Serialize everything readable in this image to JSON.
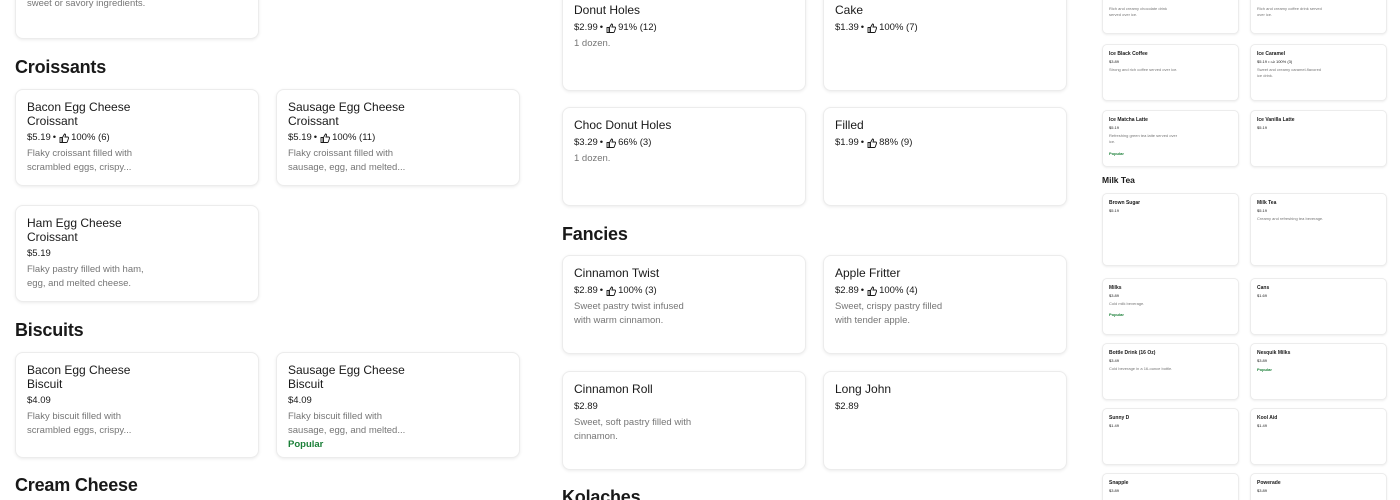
{
  "left": {
    "top_card_desc": "sweet or savory ingredients.",
    "croissants_title": "Croissants",
    "croissants": [
      {
        "name": "Bacon Egg Cheese Croissant",
        "price": "$5.19",
        "rating": "100% (6)",
        "desc": "Flaky croissant filled with scrambled eggs, crispy..."
      },
      {
        "name": "Sausage Egg Cheese Croissant",
        "price": "$5.19",
        "rating": "100% (11)",
        "desc": "Flaky croissant filled with sausage, egg, and melted..."
      },
      {
        "name": "Ham Egg Cheese Croissant",
        "price": "$5.19",
        "desc": "Flaky pastry filled with ham, egg, and melted cheese."
      }
    ],
    "biscuits_title": "Biscuits",
    "biscuits": [
      {
        "name": "Bacon Egg Cheese Biscuit",
        "price": "$4.09",
        "desc": "Flaky biscuit filled with scrambled eggs, crispy..."
      },
      {
        "name": "Sausage Egg Cheese Biscuit",
        "price": "$4.09",
        "desc": "Flaky biscuit filled with sausage, egg, and melted...",
        "badge": "Popular"
      }
    ],
    "cream_cheese_title": "Cream Cheese"
  },
  "middle": {
    "donut_holes": {
      "name": "Donut Holes",
      "price": "$2.99",
      "rating": "91% (12)",
      "desc": "1 dozen."
    },
    "cake": {
      "name": "Cake",
      "price": "$1.39",
      "rating": "100% (7)"
    },
    "choc_donut_holes": {
      "name": "Choc Donut Holes",
      "price": "$3.29",
      "rating": "66% (3)",
      "desc": "1 dozen."
    },
    "filled": {
      "name": "Filled",
      "price": "$1.99",
      "rating": "88% (9)"
    },
    "fancies_title": "Fancies",
    "cinnamon_twist": {
      "name": "Cinnamon Twist",
      "price": "$2.89",
      "rating": "100% (3)",
      "desc": "Sweet pastry twist infused with warm cinnamon."
    },
    "apple_fritter": {
      "name": "Apple Fritter",
      "price": "$2.89",
      "rating": "100% (4)",
      "desc": "Sweet, crispy pastry filled with tender apple."
    },
    "cinnamon_roll": {
      "name": "Cinnamon Roll",
      "price": "$2.89",
      "desc": "Sweet, soft pastry filled with cinnamon."
    },
    "long_john": {
      "name": "Long John",
      "price": "$2.89"
    },
    "kolaches_title": "Kolaches"
  },
  "right": {
    "top_left_desc": "Rich and creamy chocolate drink served over ice.",
    "top_right_desc": "Rich and creamy coffee drink served over ice.",
    "ice_black_coffee": {
      "name": "Ice Black Coffee",
      "price": "$3.89",
      "desc": "Strong and rich coffee served over ice."
    },
    "ice_caramel": {
      "name": "Ice Caramel",
      "price": "$5.19",
      "rating": "100% (3)",
      "desc": "Sweet and creamy caramel-flavored ice drink."
    },
    "ice_matcha_latte": {
      "name": "Ice Matcha Latte",
      "price": "$5.19",
      "desc": "Refreshing green tea latte served over ice.",
      "badge": "Popular"
    },
    "ice_vanilla_latte": {
      "name": "Ice Vanilla Latte",
      "price": "$5.19"
    },
    "milk_tea_title": "Milk Tea",
    "brown_sugar": {
      "name": "Brown Sugar",
      "price": "$5.19"
    },
    "milk_tea": {
      "name": "Milk Tea",
      "price": "$5.19",
      "desc": "Creamy and refreshing tea beverage."
    },
    "milks": {
      "name": "Milks",
      "price": "$3.89",
      "desc": "Cold milk beverage.",
      "badge": "Popular"
    },
    "cans": {
      "name": "Cans",
      "price": "$1.69"
    },
    "bottle_drink": {
      "name": "Bottle Drink (16 Oz)",
      "price": "$3.49",
      "desc": "Cold beverage in a 16-ounce bottle."
    },
    "nesquik_milks": {
      "name": "Nesquik Milks",
      "price": "$3.89",
      "badge": "Popular"
    },
    "sunny_d": {
      "name": "Sunny D",
      "price": "$1.49"
    },
    "kool_aid": {
      "name": "Kool Aid",
      "price": "$1.49"
    },
    "snapple": {
      "name": "Snapple",
      "price": "$3.89"
    },
    "powerade": {
      "name": "Powerade",
      "price": "$3.89"
    }
  },
  "separator": "•",
  "colors": {
    "popular": "#1a7f37",
    "text": "#191919",
    "muted": "#767676"
  }
}
